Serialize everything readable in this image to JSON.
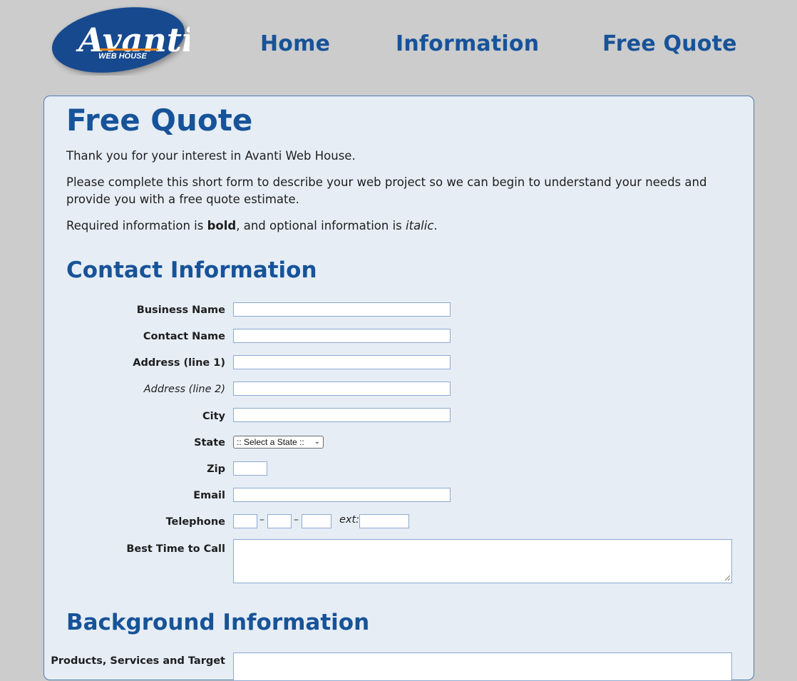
{
  "header": {
    "logo_text": "Avanti",
    "logo_subtext": "WEB HOUSE",
    "nav": {
      "home": "Home",
      "information": "Information",
      "free_quote": "Free Quote"
    }
  },
  "main": {
    "title": "Free Quote",
    "intro1": "Thank you for your interest in Avanti Web House.",
    "intro2": "Please complete this short form to describe your web project so we can begin to understand your needs and provide you with a free quote estimate.",
    "intro3_prefix": "Required information is ",
    "intro3_bold": "bold",
    "intro3_mid": ", and optional information is ",
    "intro3_italic": "italic",
    "intro3_suffix": ".",
    "contact_heading": "Contact Information",
    "background_heading": "Background Information"
  },
  "form": {
    "business_name": "Business Name",
    "contact_name": "Contact Name",
    "address1": "Address (line 1)",
    "address2": "Address (line 2)",
    "city": "City",
    "state": "State",
    "state_default": ":: Select a State ::",
    "zip": "Zip",
    "email": "Email",
    "telephone": "Telephone",
    "phone_dash": "–",
    "ext": "ext:",
    "best_time": "Best Time to Call",
    "products": "Products, Services and Target"
  },
  "colors": {
    "accent": "#175399",
    "panel": "#e6edf5",
    "page": "#cccccc",
    "border": "#4f7cac"
  }
}
